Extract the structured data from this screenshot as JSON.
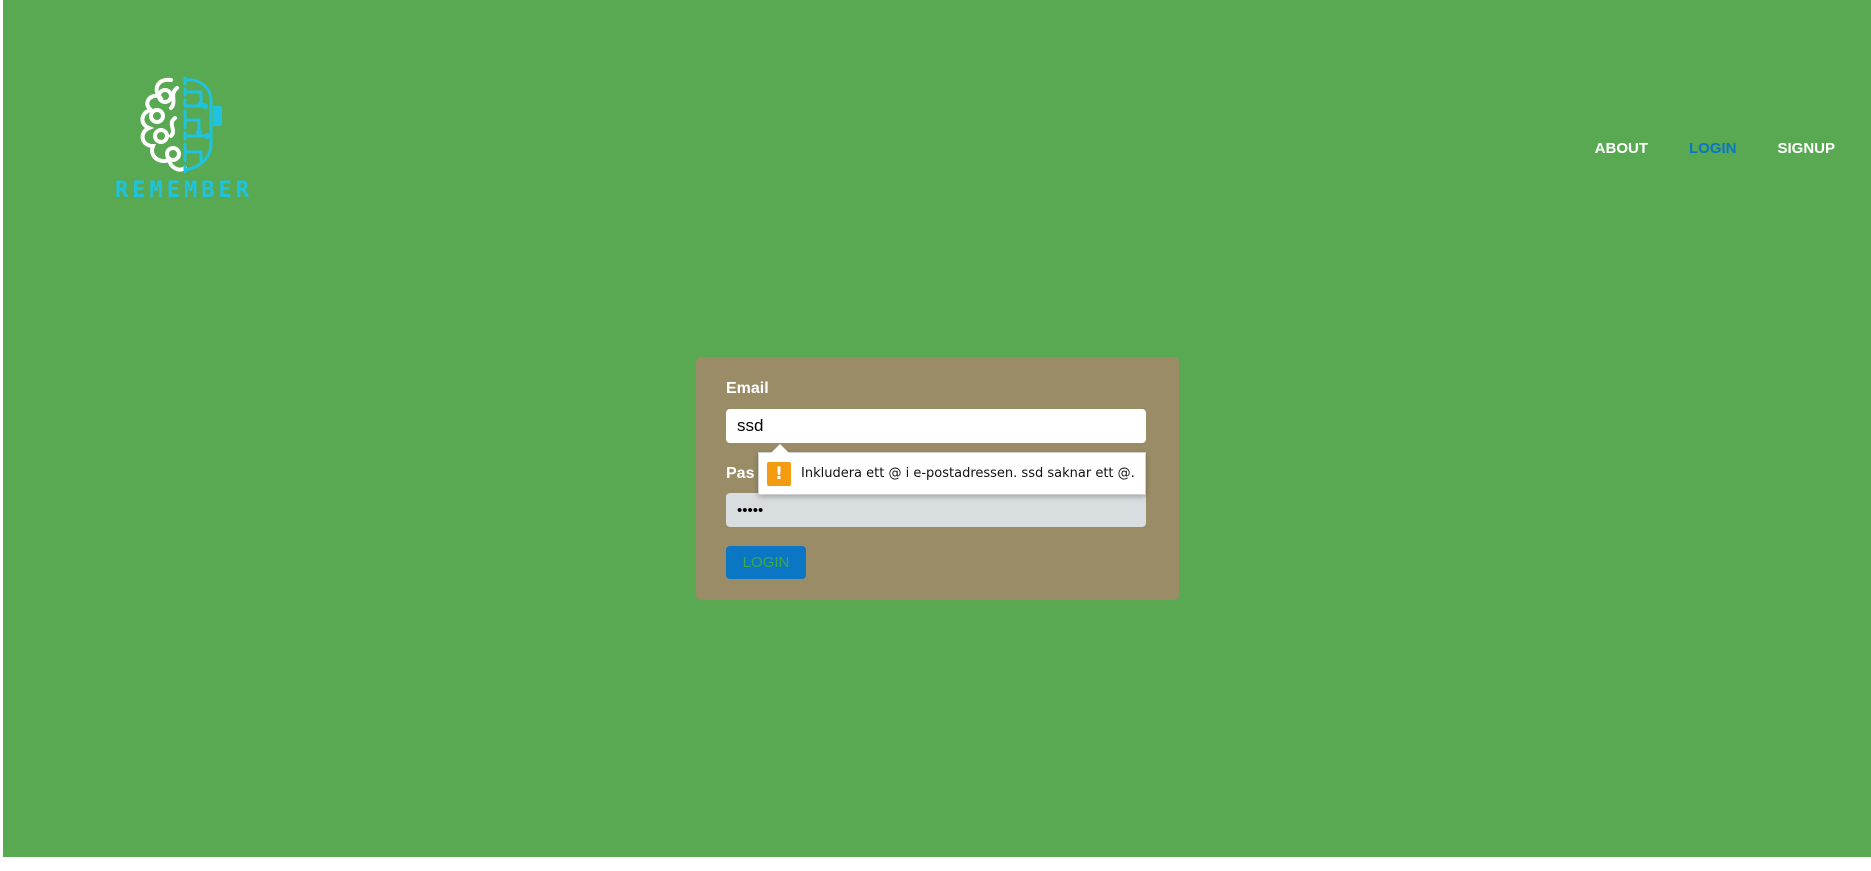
{
  "brand": {
    "name": "REMEMBER"
  },
  "nav": {
    "items": [
      {
        "label": "ABOUT"
      },
      {
        "label": "LOGIN"
      },
      {
        "label": "SIGNUP"
      }
    ],
    "active_color": "#0a76c4"
  },
  "form": {
    "email_label": "Email",
    "email_value": "ssd",
    "password_label": "Pas",
    "password_value": "•••••",
    "login_button": "LOGIN"
  },
  "validation": {
    "message": "Inkludera ett @ i e-postadressen. ssd saknar ett @.",
    "icon": "warning-icon",
    "icon_glyph": "!"
  },
  "colors": {
    "background": "#58a951",
    "card": "#9a8c66",
    "accent": "#0a76c4",
    "logo": "#1fc3df",
    "warning": "#f39c12"
  }
}
